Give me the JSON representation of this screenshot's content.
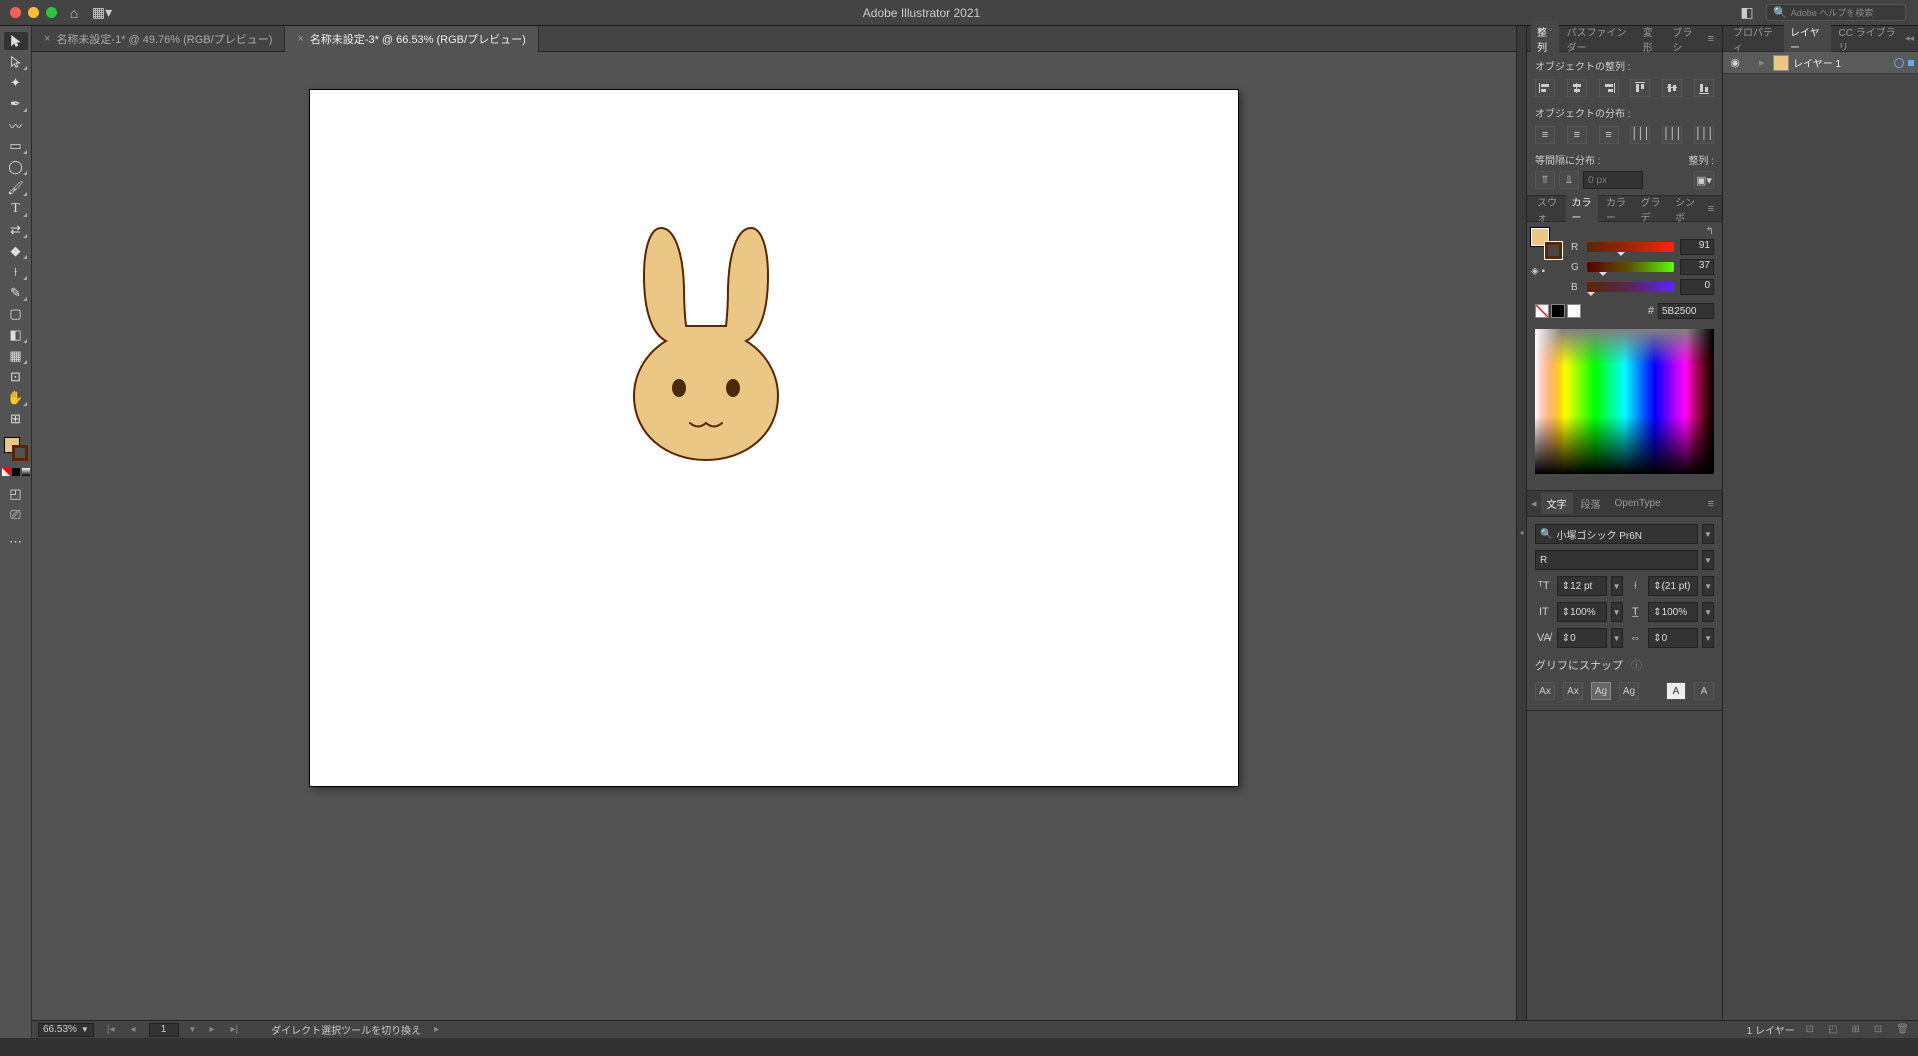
{
  "app": {
    "title": "Adobe Illustrator 2021",
    "search_placeholder": "Adobe ヘルプを検索"
  },
  "tabs": [
    {
      "label": "名称未設定-1* @ 49.76% (RGB/プレビュー)",
      "active": false
    },
    {
      "label": "名称未設定-3* @ 66.53% (RGB/プレビュー)",
      "active": true
    }
  ],
  "panels": {
    "align": {
      "tabs": [
        "整列",
        "パスファインダー",
        "変形",
        "ブラシ"
      ],
      "section1": "オブジェクトの整列 :",
      "section2": "オブジェクトの分布 :",
      "section3": "等間隔に分布 :",
      "section3b": "整列 :",
      "spacing_value": "0 px"
    },
    "color": {
      "tabs": [
        "スウォ",
        "カラー",
        "カラー",
        "グラデ",
        "シンボ"
      ],
      "r": "91",
      "g": "37",
      "b": "0",
      "hex_prefix": "#",
      "hex": "5B2500"
    },
    "character": {
      "tabs": [
        "文字",
        "段落",
        "OpenType"
      ],
      "font": "小塚ゴシック Pr6N",
      "style": "R",
      "size": "12 pt",
      "leading": "(21 pt)",
      "vscale": "100%",
      "hscale": "100%",
      "tracking": "0",
      "kerning": "0",
      "glyph_label": "グリフにスナップ"
    },
    "right_tabs": [
      "プロパティ",
      "レイヤー",
      "CC ライブラリ"
    ],
    "layers": {
      "items": [
        {
          "name": "レイヤー 1"
        }
      ]
    }
  },
  "status": {
    "zoom": "66.53%",
    "artboard": "1",
    "tool_hint": "ダイレクト選択ツールを切り換え",
    "layer_count": "1 レイヤー"
  },
  "artwork": {
    "fill": "#eac784",
    "stroke": "#5b2500"
  }
}
